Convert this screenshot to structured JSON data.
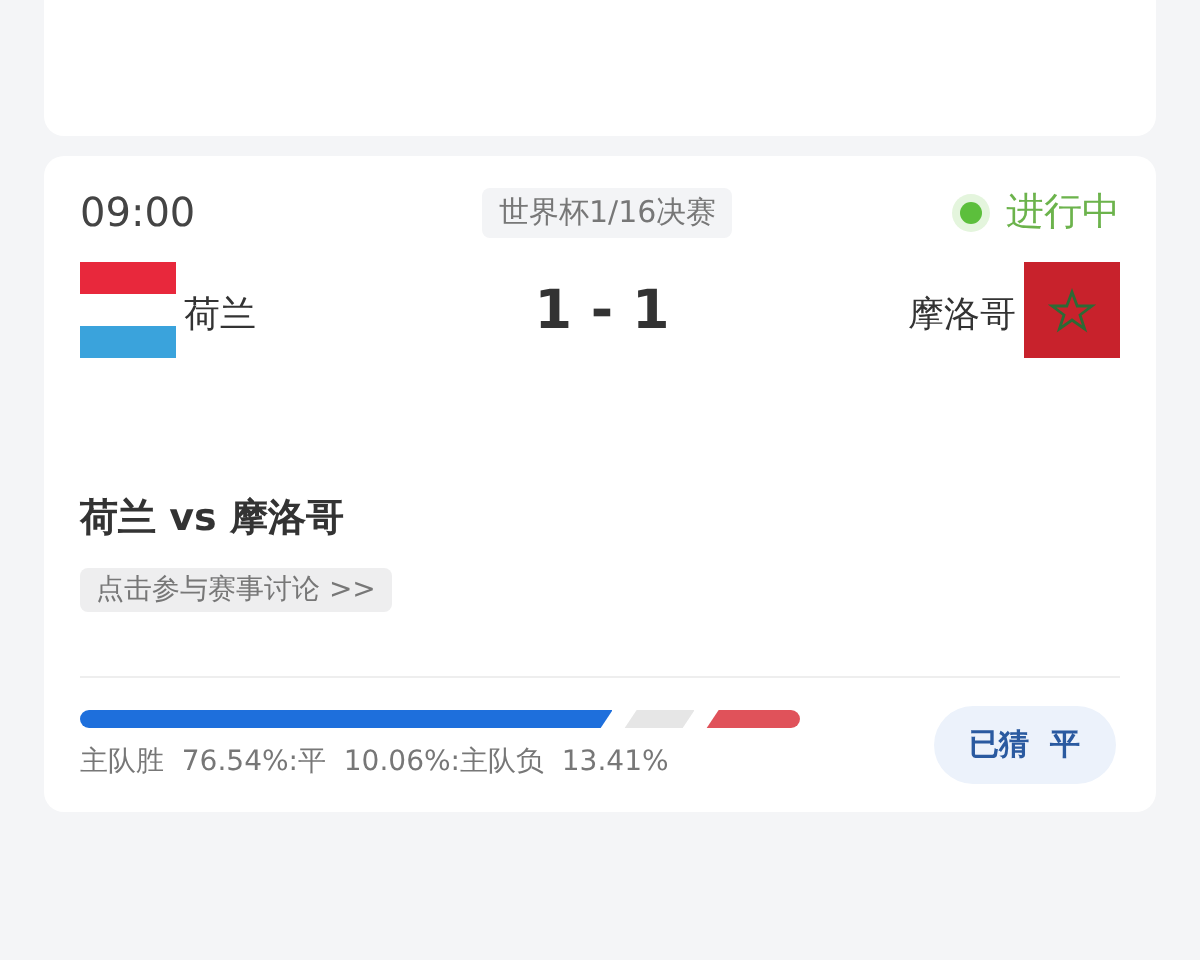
{
  "match": {
    "time": "09:00",
    "stage": "世界杯1/16决赛",
    "status": {
      "label": "进行中",
      "live": true
    },
    "home": {
      "name": "荷兰"
    },
    "away": {
      "name": "摩洛哥"
    },
    "score": "1 - 1",
    "title": "荷兰 vs 摩洛哥",
    "discussion_link": "点击参与赛事讨论 >>"
  },
  "prediction": {
    "segments": [
      {
        "color": "#1e6fdc"
      },
      {
        "color": "#e6e6e6"
      },
      {
        "color": "#e0525a"
      }
    ],
    "summary": "主队胜  76.54%:平  10.06%:主队负  13.41%",
    "guess_button": "已猜  平"
  }
}
